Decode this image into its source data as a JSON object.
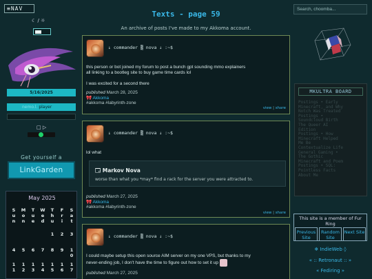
{
  "header": {
    "nav_label": "≡NAV",
    "title": "Texts - page 59",
    "subtitle": "I've made to my Akkoma account.",
    "subtitle_full": "An archive of posts I've made to my Akkoma account.",
    "search_placeholder": "Search, choomba..."
  },
  "sidebar": {
    "theme_icons": "☾ / ☼",
    "date": "5/16/2025",
    "player_label": "player",
    "player_dim": "nemo.l.",
    "controls": "□  ▷",
    "volume_level": 0.45,
    "get_yourself": "Get yourself a",
    "linkgarden": "LinkGarden"
  },
  "calendar": {
    "title": "May 2025",
    "days": [
      "S",
      "M",
      "T",
      "W",
      "T",
      "F",
      "S"
    ],
    "days2": [
      "u",
      "o",
      "u",
      "e",
      "h",
      "r",
      "a"
    ],
    "days3": [
      "n",
      "n",
      "e",
      "d",
      "u",
      "i",
      "t"
    ],
    "row1": [
      "",
      "",
      "",
      "",
      "1",
      "2",
      "3"
    ],
    "row2": [
      "4",
      "5",
      "6",
      "7",
      "8",
      "9",
      "1"
    ],
    "row2b": [
      "",
      "",
      "",
      "",
      "",
      "",
      "0"
    ],
    "row3": [
      "1",
      "1",
      "1",
      "1",
      "1",
      "1",
      "1"
    ],
    "row3b": [
      "1",
      "2",
      "3",
      "4",
      "5",
      "6",
      "7"
    ]
  },
  "posts": [
    {
      "header": "↓ commander ▒ nova ↓ :~$",
      "lines": [
        "this person or bot joined my forum to post a bunch gpt sounding mmo explainers",
        "all linking to a bootleg site to buy game time cards lol",
        "",
        "I was excited for a second there"
      ],
      "published_label": "published",
      "date": "March 28, 2025",
      "platform": "Akkoma",
      "tags": "#akkoma #labyrinth-zone",
      "view": "view",
      "share": "share"
    },
    {
      "header": "↓ commander ▒ nova ↓ :~$",
      "lines": [
        "lol what"
      ],
      "quote_name": "Markov Nova",
      "quote_text": "worse than what you *may* find a rack for the server you were attracted to.",
      "published_label": "published",
      "date": "March 27, 2025",
      "platform": "Akkoma",
      "tags": "#akkoma #labyrinth-zone",
      "view": "view",
      "share": "share"
    },
    {
      "header": "↓ commander ▒ nova ↓ :~$",
      "lines": [
        "I could maybe setup this open source AIM server on my one VPS, but thanks to my",
        "never-ending job, I don't have the time to figure out how to set it up"
      ],
      "published_label": "published",
      "date": "March 27, 2025"
    }
  ],
  "right": {
    "mkultra_title": "MKULTRA BOARD",
    "mkultra_lines": [
      "Postings • Early",
      "Minecraft, and Why",
      "Notch Was Treated",
      "Postings •",
      "Soundcloud Birth",
      "The Queer AI",
      "Edition",
      "Postings • How",
      "Minecraft Helped",
      "Me Be",
      "Contextualize Life",
      "General Gaming •",
      "The Gothic",
      "Minecraft and Poem",
      "Postings • SQL:",
      "Pointless Facts",
      "About Me"
    ],
    "webring_text": "This site is a member of Fur Ring",
    "webring_prev": "Previous Site",
    "webring_random": "Random Site",
    "webring_next": "Next Site",
    "indieweb": "❄ IndieWeb ◊",
    "retronaut": "« :: Retronaut :: »",
    "fediring": "« Fediring »"
  }
}
